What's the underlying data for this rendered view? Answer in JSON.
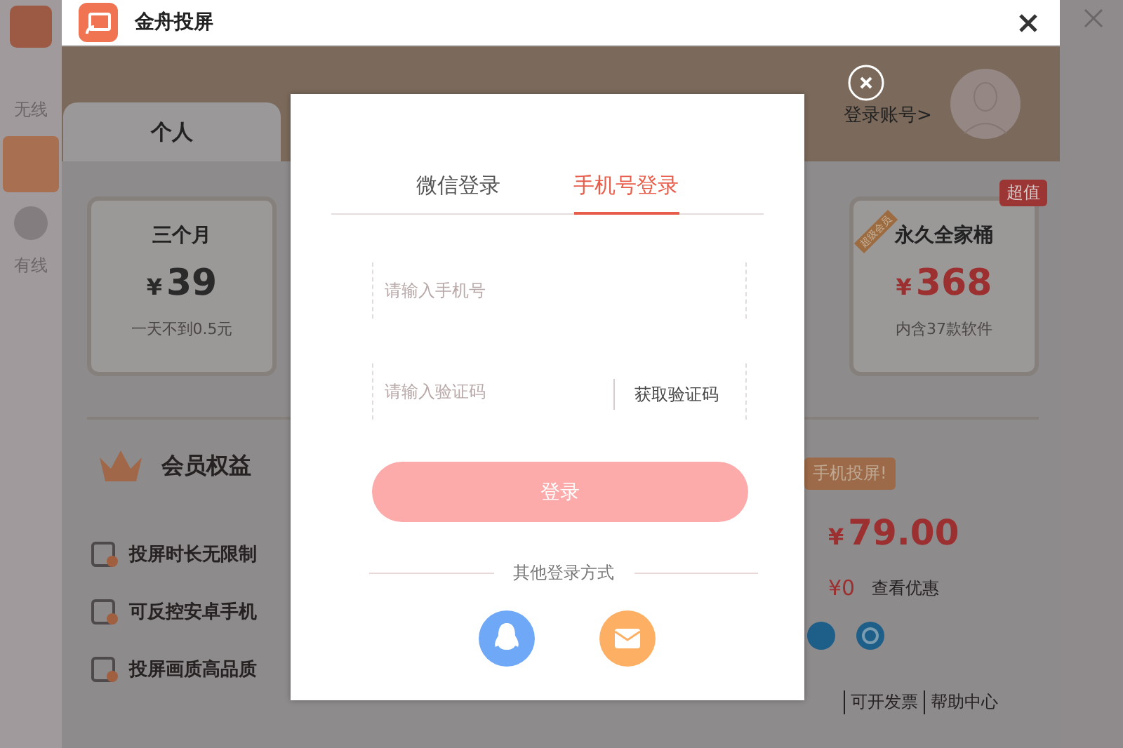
{
  "side_app": {
    "items": [
      {
        "label": "无线"
      },
      {
        "label": "有线"
      }
    ]
  },
  "window": {
    "title": "金舟投屏"
  },
  "header": {
    "account_link": "登录账号>"
  },
  "plan_tabs": [
    {
      "label": "个人",
      "selected": true
    }
  ],
  "plans": [
    {
      "name": "三个月",
      "currency": "¥",
      "price": "39",
      "note": "一天不到0.5元",
      "highlight": false
    },
    {
      "name": "永久全家桶",
      "currency": "¥",
      "price": "368",
      "note": "内含37款软件",
      "highlight": true,
      "tag": "超值",
      "ribbon": "超级会员"
    }
  ],
  "benefits": {
    "title": "会员权益",
    "items": [
      "投屏时长无限制",
      "可反控安卓手机",
      "投屏画质高品质"
    ]
  },
  "order": {
    "promo": "手机投屏!",
    "currency": "¥",
    "total": "79.00",
    "discount_currency": "¥",
    "discount": "0",
    "discount_link": "查看优惠"
  },
  "footer_links": [
    "可开发票",
    "帮助中心"
  ],
  "login_dialog": {
    "tabs": [
      {
        "label": "微信登录",
        "selected": false
      },
      {
        "label": "手机号登录",
        "selected": true
      }
    ],
    "phone": {
      "placeholder": "请输入手机号"
    },
    "code": {
      "placeholder": "请输入验证码"
    },
    "get_code": "获取验证码",
    "submit": "登录",
    "other_methods": "其他登录方式"
  }
}
